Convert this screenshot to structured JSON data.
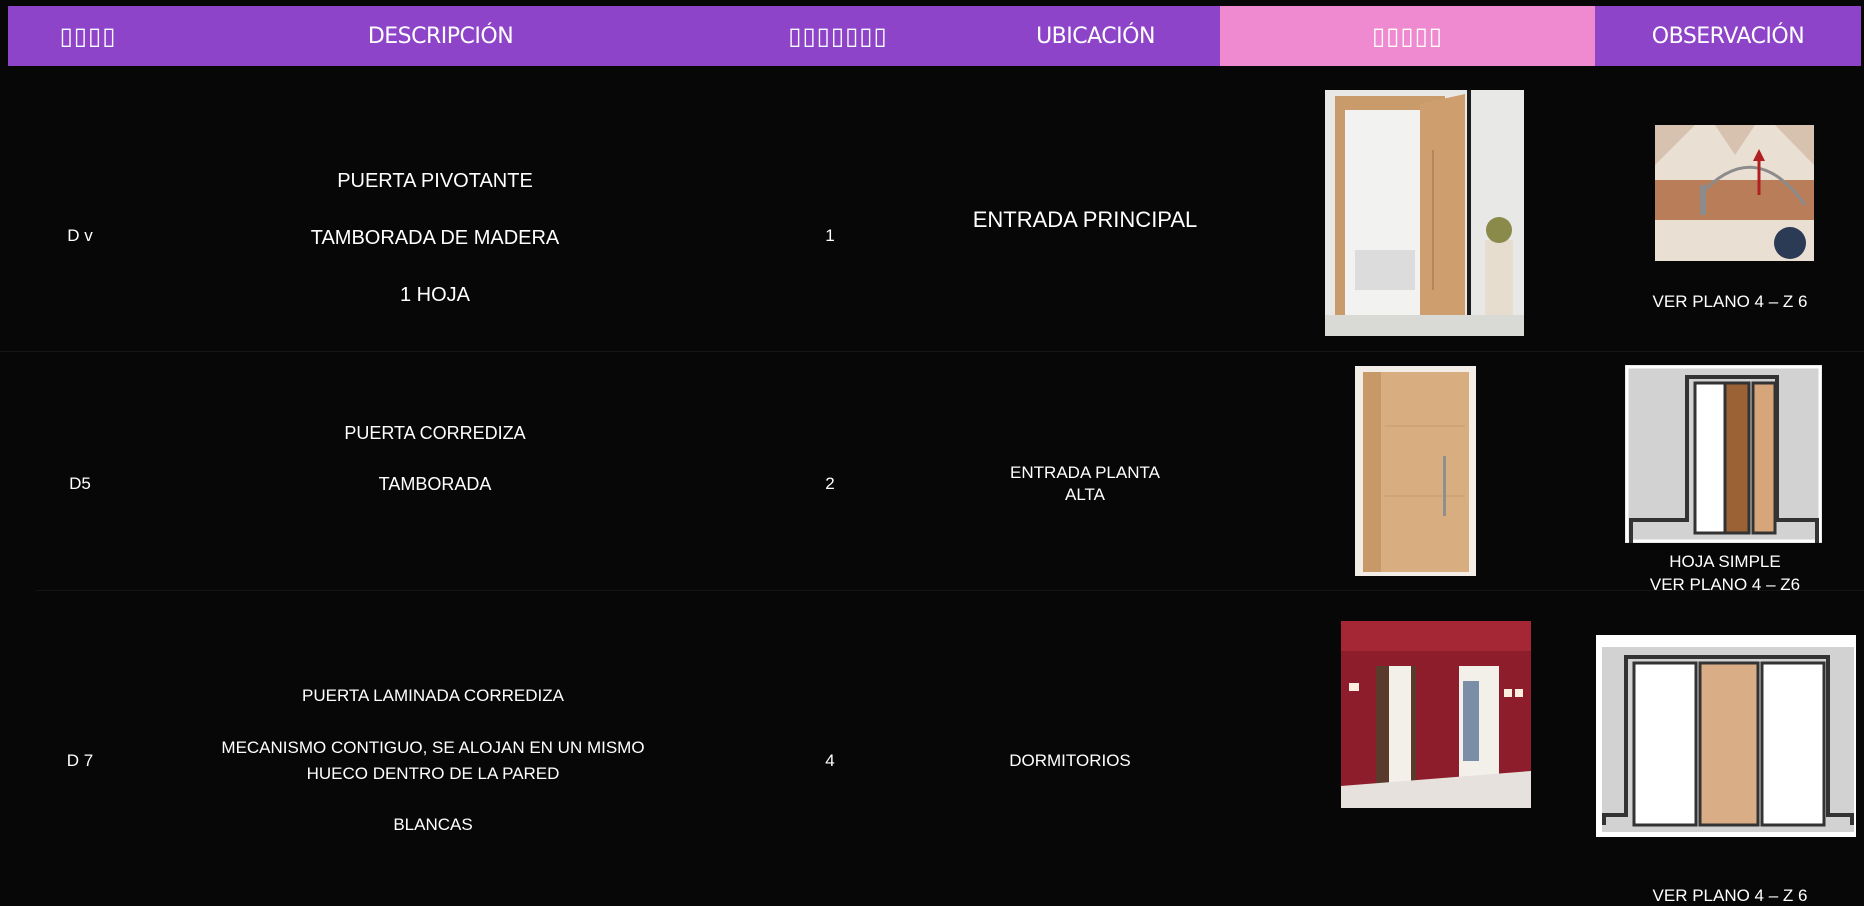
{
  "header": {
    "columns": [
      "▯▯▯▯",
      "DESCRIPCIÓN",
      "▯▯▯▯▯▯▯",
      "UBICACIÓN",
      "▯▯▯▯▯",
      "OBSERVACIÓN"
    ],
    "colors": {
      "bar": "#8e44c8",
      "highlight": "#f08ad0"
    }
  },
  "rows": [
    {
      "code": "D v",
      "description": [
        "PUERTA PIVOTANTE",
        "TAMBORADA DE MADERA",
        "1 HOJA"
      ],
      "quantity": "1",
      "location": "ENTRADA PRINCIPAL",
      "observation": [
        "VER PLANO 4 – Z 6"
      ]
    },
    {
      "code": "D5",
      "description": [
        "PUERTA CORREDIZA",
        "TAMBORADA"
      ],
      "quantity": "2",
      "location": [
        "ENTRADA PLANTA",
        "ALTA"
      ],
      "observation": [
        "HOJA SIMPLE",
        "VER PLANO 4 – Z6"
      ]
    },
    {
      "code": "D 7",
      "description": [
        "PUERTA LAMINADA  CORREDIZA",
        "MECANISMO CONTIGUO, SE ALOJAN EN UN MISMO",
        "HUECO DENTRO DE LA PARED",
        "BLANCAS"
      ],
      "quantity": "4",
      "location": "DORMITORIOS",
      "observation": [
        "VER PLANO 4 – Z 6"
      ]
    }
  ]
}
